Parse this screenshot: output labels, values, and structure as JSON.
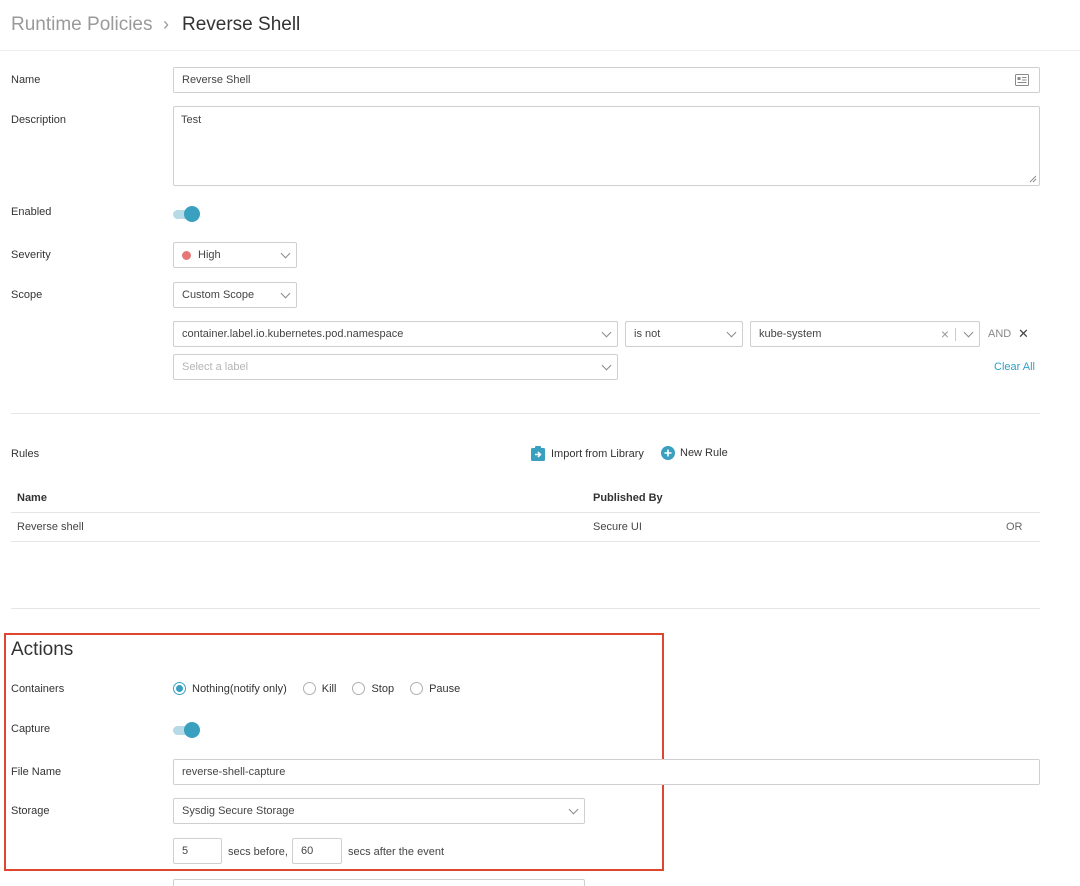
{
  "breadcrumb": {
    "parent": "Runtime Policies",
    "separator": "›",
    "current": "Reverse Shell"
  },
  "form": {
    "name_label": "Name",
    "name_value": "Reverse Shell",
    "description_label": "Description",
    "description_value": "Test",
    "enabled_label": "Enabled",
    "enabled_on": true,
    "severity_label": "Severity",
    "severity_value": "High",
    "severity_color": "#e57777",
    "scope_label": "Scope",
    "scope_value": "Custom Scope",
    "scope_rule": {
      "label_key": "container.label.io.kubernetes.pod.namespace",
      "operator": "is not",
      "value": "kube-system",
      "clear_symbol": "×",
      "conjunction": "AND",
      "remove_symbol": "✕"
    },
    "select_label_placeholder": "Select a label",
    "clear_all": "Clear All"
  },
  "rules": {
    "label": "Rules",
    "import_from_library": "Import from Library",
    "new_rule": "New Rule",
    "columns": {
      "name": "Name",
      "published_by": "Published By"
    },
    "rows": [
      {
        "name": "Reverse shell",
        "published_by": "Secure UI",
        "operator": "OR"
      }
    ]
  },
  "actions": {
    "title": "Actions",
    "containers_label": "Containers",
    "container_options": [
      "Nothing(notify only)",
      "Kill",
      "Stop",
      "Pause"
    ],
    "selected_option": "Nothing(notify only)",
    "capture_label": "Capture",
    "capture_on": true,
    "file_name_label": "File Name",
    "file_name_value": "reverse-shell-capture",
    "storage_label": "Storage",
    "storage_value": "Sysdig Secure Storage",
    "secs_before_value": "5",
    "secs_before_text": "secs before,",
    "secs_after_value": "60",
    "secs_after_text": "secs after the event"
  },
  "colors": {
    "accent": "#3aa0c0",
    "highlight": "#e0452f",
    "link": "#2ea0c8"
  }
}
